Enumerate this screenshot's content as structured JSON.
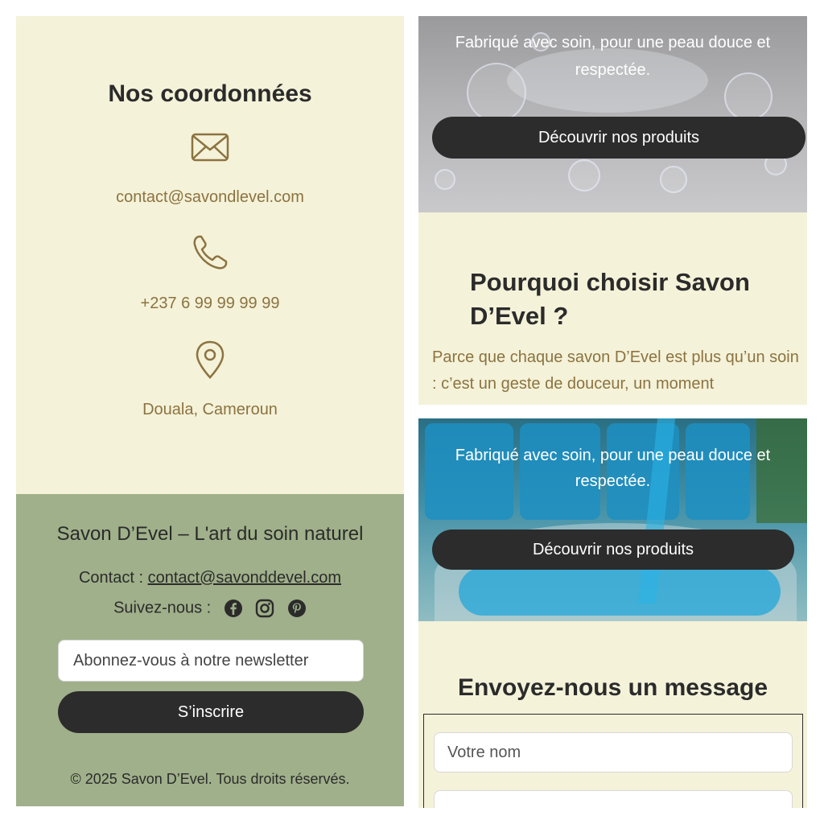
{
  "contact_section": {
    "title": "Nos coordonnées",
    "email": "contact@savondlevel.com",
    "phone": "+237 6 99 99 99 99",
    "location": "Douala, Cameroun",
    "icons": [
      "envelope-icon",
      "phone-icon",
      "location-pin-icon"
    ],
    "accent_color": "#8c7340"
  },
  "footer": {
    "title": "Savon D’Evel – L'art du soin naturel",
    "contact_prefix": "Contact : ",
    "contact_email": "contact@savonddevel.com",
    "follow_label": "Suivez-nous :",
    "social_icons": [
      "facebook-icon",
      "instagram-icon",
      "pinterest-icon"
    ],
    "newsletter_placeholder": "Abonnez-vous à notre newsletter",
    "subscribe_label": "S’inscrire",
    "copyright": "© 2025 Savon D’Evel. Tous droits réservés.",
    "background_color": "#a0b08a"
  },
  "hero_top": {
    "tagline": "Fabriqué avec soin, pour une peau douce et respectée.",
    "cta_label": "Découvrir nos produits"
  },
  "why_section": {
    "title": "Pourquoi choisir Savon D’Evel ?",
    "body": "Parce que chaque savon D’Evel est plus qu’un soin : c’est un geste de douceur, un moment"
  },
  "hero_bottom": {
    "tagline": "Fabriqué avec soin, pour une peau douce et respectée.",
    "cta_label": "Découvrir nos produits"
  },
  "message_section": {
    "title": "Envoyez-nous un message",
    "name_placeholder": "Votre nom"
  },
  "colors": {
    "cream": "#f4f2d9",
    "dark_button": "#2c2c2c",
    "text_dark": "#2b2b2b"
  }
}
